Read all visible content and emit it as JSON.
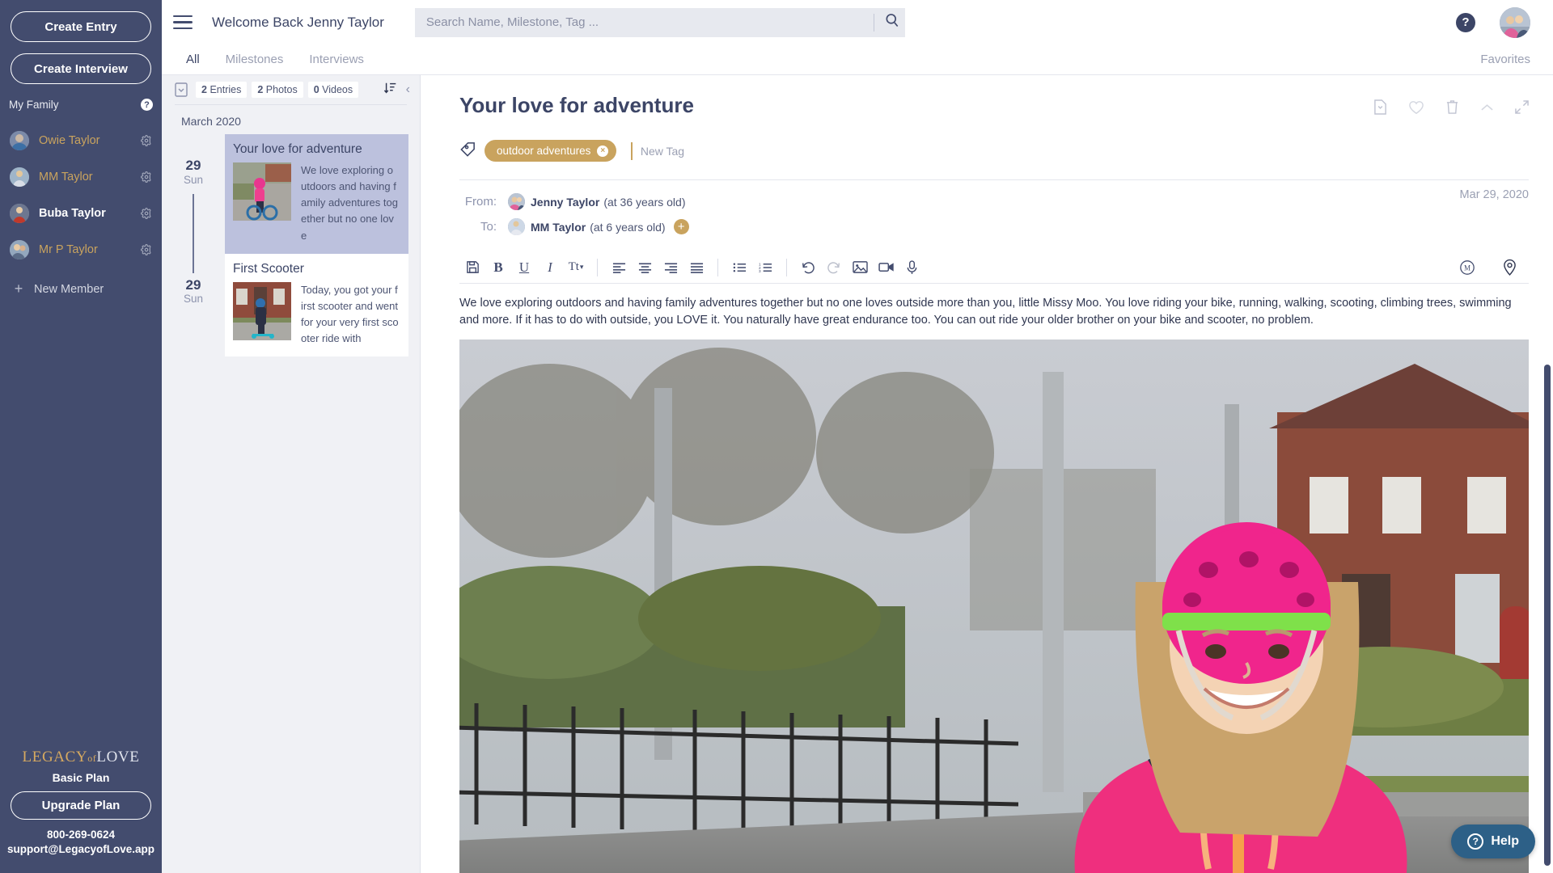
{
  "sidebar": {
    "create_entry_label": "Create Entry",
    "create_interview_label": "Create Interview",
    "my_family_label": "My Family",
    "help_glyph": "?",
    "members": [
      {
        "name": "Owie Taylor",
        "active": false
      },
      {
        "name": "MM Taylor",
        "active": false
      },
      {
        "name": "Buba Taylor",
        "active": true
      },
      {
        "name": "Mr P Taylor",
        "active": false
      }
    ],
    "new_member_label": "New Member",
    "new_member_glyph": "+",
    "logo_legacy": "LEGACY",
    "logo_of": "of",
    "logo_love": "LOVE",
    "plan_name": "Basic Plan",
    "upgrade_label": "Upgrade Plan",
    "phone": "800-269-0624",
    "email": "support@LegacyofLove.app"
  },
  "topbar": {
    "welcome": "Welcome Back Jenny Taylor",
    "search_placeholder": "Search Name, Milestone, Tag ...",
    "search_value": "",
    "help_glyph": "?"
  },
  "tabs": [
    {
      "label": "All",
      "active": true
    },
    {
      "label": "Milestones",
      "active": false
    },
    {
      "label": "Interviews",
      "active": false
    }
  ],
  "favorites_label": "Favorites",
  "timeline": {
    "counts": [
      {
        "count": "2",
        "unit": "Entries"
      },
      {
        "count": "2",
        "unit": "Photos"
      },
      {
        "count": "0",
        "unit": "Videos"
      }
    ],
    "month": "March 2020",
    "collapse_glyph": "‹",
    "entries": [
      {
        "day": "29",
        "dow": "Sun",
        "title": "Your love for adventure",
        "snippet": "We love exploring outdoors and having family adventures together but no one love",
        "selected": true
      },
      {
        "day": "29",
        "dow": "Sun",
        "title": "First Scooter",
        "snippet": "Today, you got your first scooter and went for your very first scooter ride with",
        "selected": false
      }
    ]
  },
  "entry": {
    "title": "Your love for adventure",
    "actions": [
      "export-icon",
      "heart-icon",
      "trash-icon",
      "chevron-up-icon",
      "expand-icon"
    ],
    "tag_icon": "tag-icon",
    "tags": [
      {
        "label": "outdoor adventures",
        "remove_glyph": "×"
      }
    ],
    "new_tag_label": "New Tag",
    "from_label": "From:",
    "from_name": "Jenny Taylor",
    "from_age": "(at 36 years old)",
    "to_label": "To:",
    "to_name": "MM Taylor",
    "to_age": "(at 6 years old)",
    "add_recipient_glyph": "+",
    "date": "Mar 29, 2020",
    "toolbar": {
      "save": "save-icon",
      "bold": "B",
      "underline": "U",
      "italic": "I",
      "text_size": "Tt",
      "align_left": "align-left-icon",
      "align_center": "align-center-icon",
      "align_right": "align-right-icon",
      "align_justify": "align-justify-icon",
      "bullet_list": "bullet-list-icon",
      "number_list": "numbered-list-icon",
      "undo": "undo-icon",
      "redo": "redo-icon",
      "image": "image-icon",
      "video": "video-icon",
      "mic": "microphone-icon",
      "music": "music-icon",
      "location": "location-pin-icon"
    },
    "body": "We love exploring outdoors and having family adventures together but no one loves outside more than you, little Missy Moo. You love riding your bike, running, walking, scooting, climbing trees, swimming and more. If it has to do with outside, you LOVE it. You naturally have great endurance too. You can out ride your older brother on your bike and scooter, no problem."
  },
  "help_fab": {
    "label": "Help",
    "glyph": "?"
  }
}
